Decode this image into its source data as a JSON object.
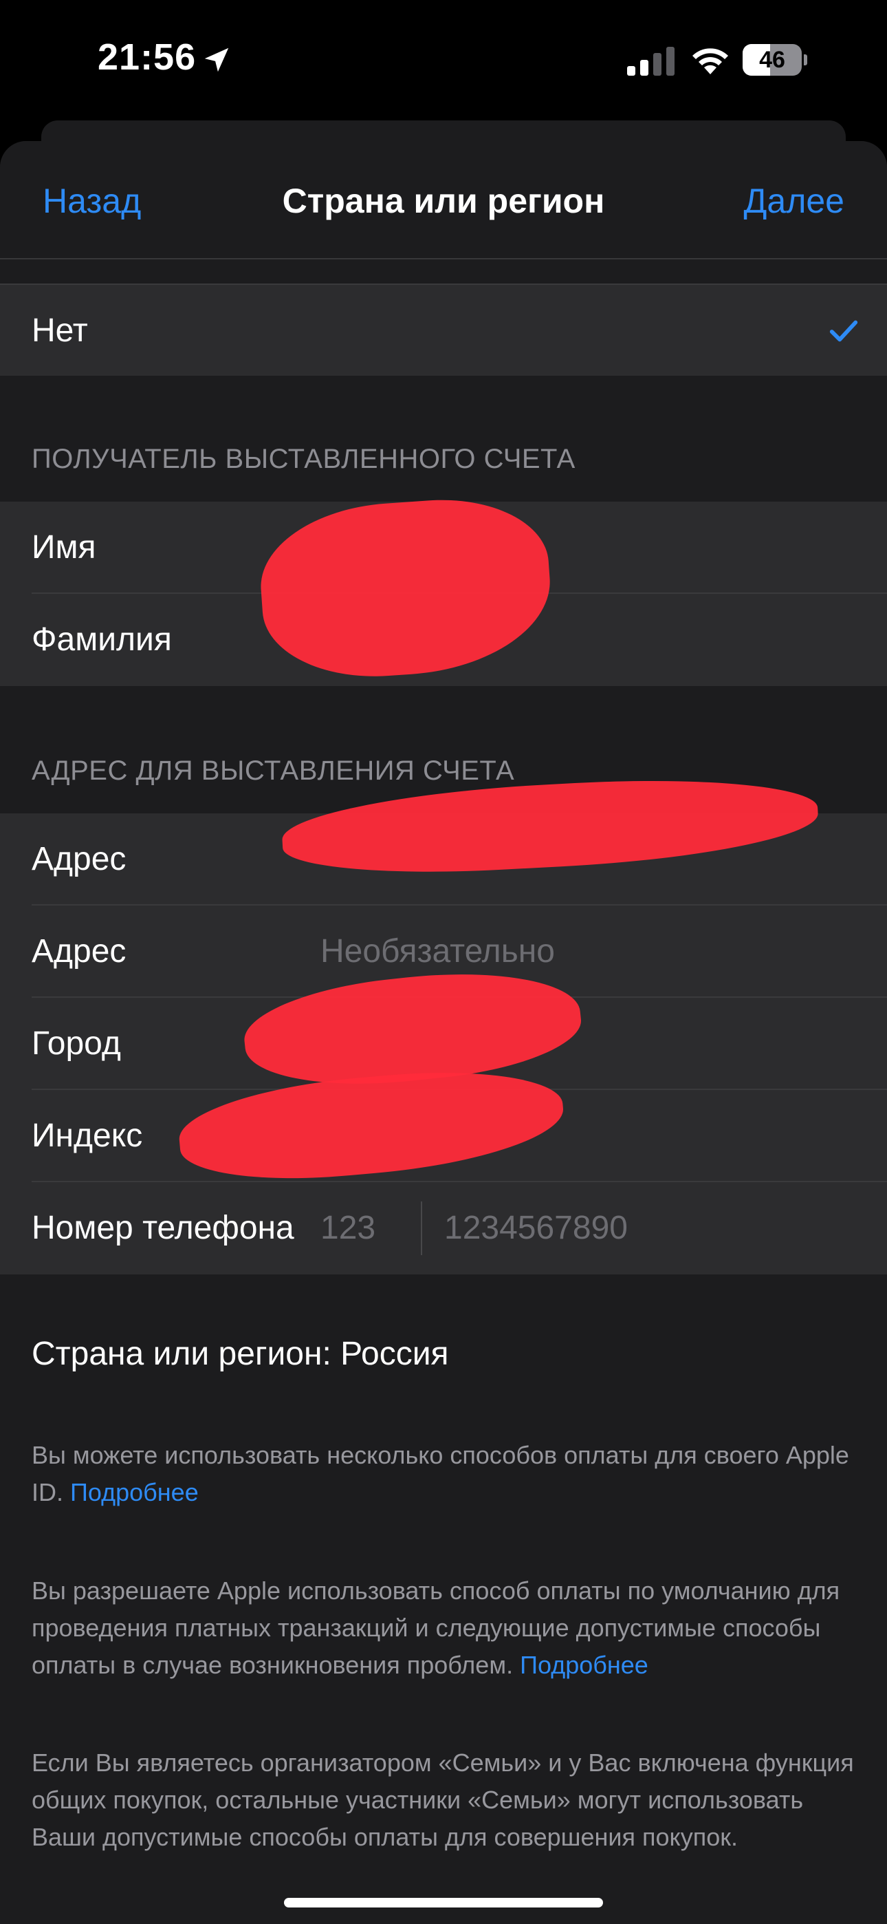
{
  "status_bar": {
    "time": "21:56",
    "battery_level": "46",
    "battery_fraction": 0.46
  },
  "nav": {
    "back_label": "Назад",
    "title": "Страна или регион",
    "next_label": "Далее"
  },
  "selection": {
    "option_label": "Нет",
    "checked": true
  },
  "billing_recipient": {
    "header": "ПОЛУЧАТЕЛЬ ВЫСТАВЛЕННОГО СЧЕТА",
    "first_name_label": "Имя",
    "last_name_label": "Фамилия"
  },
  "billing_address": {
    "header": "АДРЕС ДЛЯ ВЫСТАВЛЕНИЯ СЧЕТА",
    "address1_label": "Адрес",
    "address2_label": "Адрес",
    "address2_placeholder": "Необязательно",
    "city_label": "Город",
    "zip_label": "Индекс",
    "phone_label": "Номер телефона",
    "phone_code_placeholder": "123",
    "phone_number_placeholder": "1234567890"
  },
  "footer": {
    "country_line": "Страна или регион: Россия",
    "p1_text": "Вы можете использовать несколько способов оплаты для своего Apple ID.",
    "p1_link": "Подробнее",
    "p2_text": "Вы разрешаете Apple использовать способ оплаты по умолчанию для проведения платных транзакций и следующие допустимые способы оплаты в случае возникновения проблем.",
    "p2_link": "Подробнее",
    "p3_text": "Если Вы являетесь организатором «Семьи» и у Вас включена функция общих покупок, остальные участники «Семьи» могут использовать Ваши допустимые способы оплаты для совершения покупок."
  },
  "colors": {
    "accent": "#2e8bf5",
    "sheet_bg": "#1c1c1e",
    "cell_bg": "#2c2c2e",
    "redaction": "#ff2b3a"
  }
}
